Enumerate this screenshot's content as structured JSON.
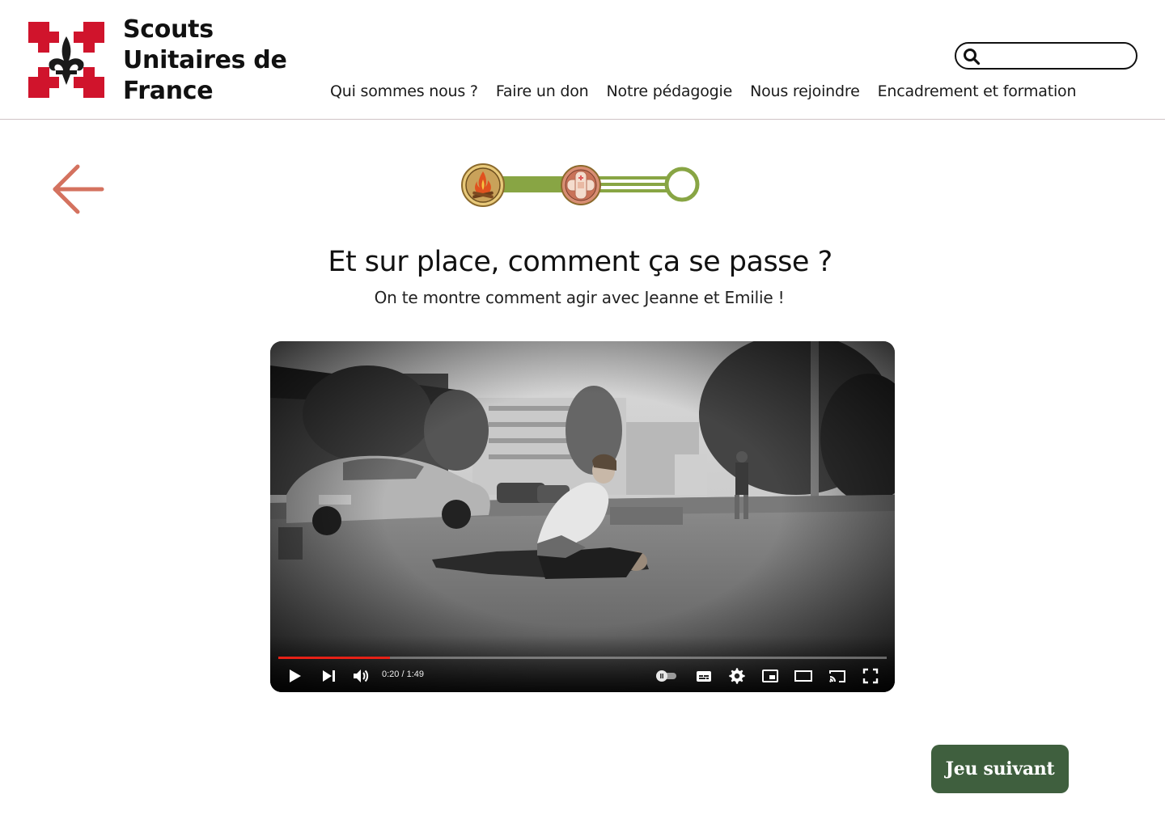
{
  "header": {
    "brand_line1": "Scouts",
    "brand_line2": "Unitaires de",
    "brand_line3": "France",
    "logo_icon": "scout-cross-fleur-de-lis-icon",
    "search": {
      "placeholder": "",
      "value": "",
      "icon": "search-icon"
    },
    "nav": [
      {
        "label": "Qui sommes nous ?"
      },
      {
        "label": "Faire un don"
      },
      {
        "label": "Notre pédagogie"
      },
      {
        "label": "Nous rejoindre"
      },
      {
        "label": "Encadrement et formation"
      }
    ]
  },
  "back": {
    "icon": "arrow-left-icon",
    "color": "#d4725f"
  },
  "progress": {
    "steps": [
      {
        "icon": "campfire-icon",
        "state": "completed"
      },
      {
        "icon": "bandage-icon",
        "state": "current"
      },
      {
        "icon": "empty-circle-icon",
        "state": "upcoming"
      }
    ],
    "color": "#88a544"
  },
  "main": {
    "title": "Et sur place, comment ça se passe ?",
    "subtitle": "On te montre comment agir avec Jeanne et Emilie !"
  },
  "video": {
    "time_display": "0:20 / 1:49",
    "progress_fraction": 0.183,
    "controls": [
      "play-icon",
      "next-icon",
      "volume-icon",
      "autoplay-toggle-icon",
      "subtitles-icon",
      "settings-gear-icon",
      "miniplayer-icon",
      "theater-mode-icon",
      "cast-icon",
      "fullscreen-icon"
    ]
  },
  "footer": {
    "next_label": "Jeu suivant",
    "next_color": "#3f5f3e"
  },
  "colors": {
    "brand_red": "#d0142c",
    "accent_green": "#88a544",
    "back_arrow": "#d4725f"
  }
}
